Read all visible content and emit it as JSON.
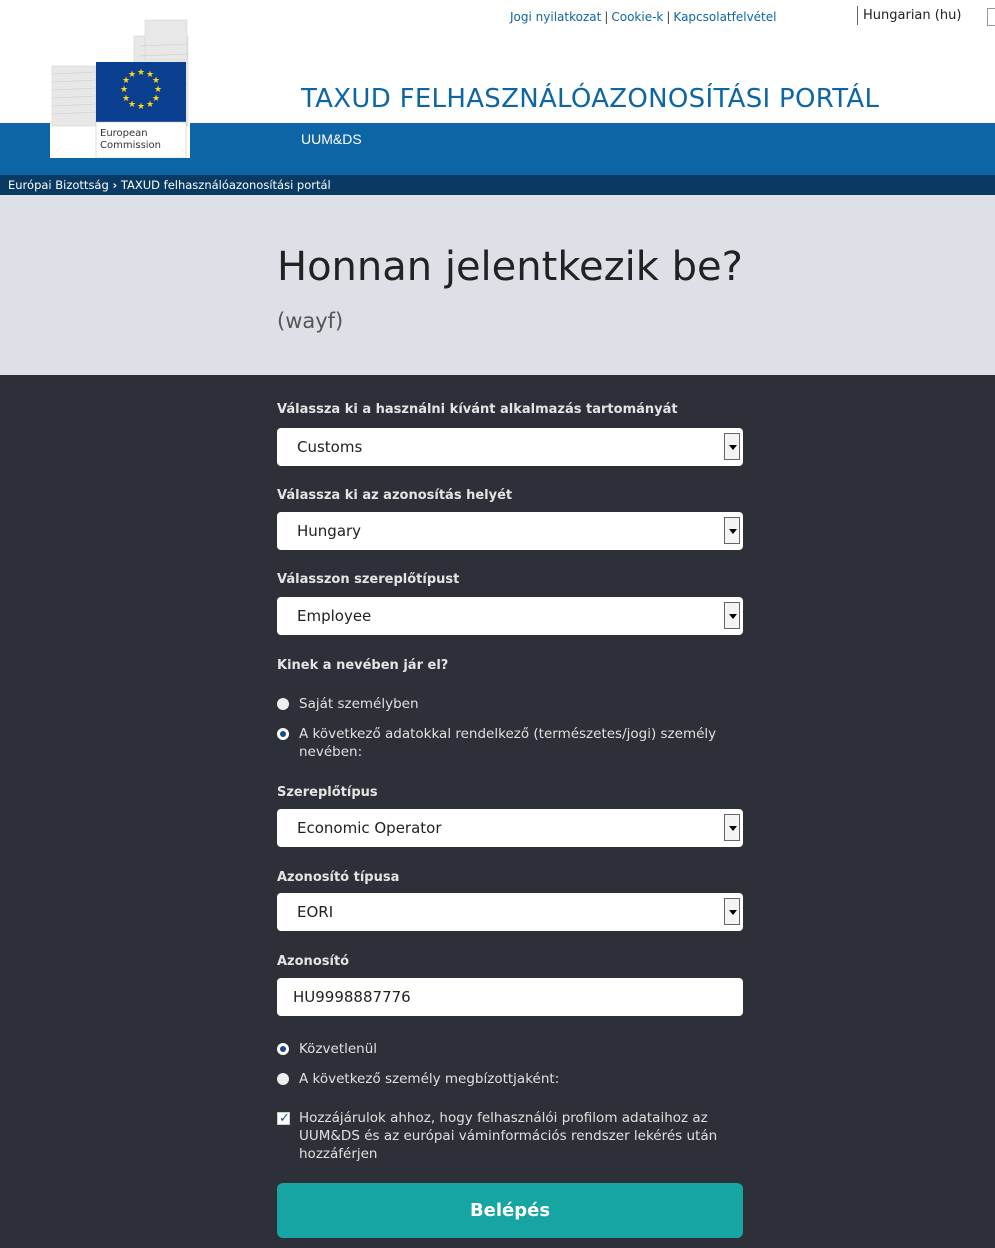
{
  "top_links": {
    "legal": "Jogi nyilatkozat",
    "cookies": "Cookie-k",
    "contact": "Kapcsolatfelvétel",
    "separator": "|",
    "language": "Hungarian (hu)"
  },
  "logo": {
    "line1": "European",
    "line2": "Commission"
  },
  "header": {
    "title": "TAXUD FELHASZNÁLÓAZONOSÍTÁSI PORTÁL",
    "subtitle": "UUM&DS"
  },
  "breadcrumb": {
    "item1": "Európai Bizottság",
    "separator": "›",
    "item2": "TAXUD felhasználóazonosítási portál"
  },
  "hero": {
    "title": "Honnan jelentkezik be?",
    "tag": "(wayf)"
  },
  "form": {
    "domain_label": "Válassza ki a használni kívánt alkalmazás tartományát",
    "domain_value": "Customs",
    "location_label": "Válassza ki az azonosítás helyét",
    "location_value": "Hungary",
    "actor_type_label": "Válasszon szereplőtípust",
    "actor_type_value": "Employee",
    "behalf_label": "Kinek a nevében jár el?",
    "behalf_options": [
      "Saját személyben",
      "A következő adatokkal rendelkező (természetes/jogi) személy nevében:"
    ],
    "behalf_selected": 1,
    "role_label": "Szereplőtípus",
    "role_value": "Economic Operator",
    "id_type_label": "Azonosító típusa",
    "id_type_value": "EORI",
    "id_label": "Azonosító",
    "id_value": "HU9998887776",
    "mode_options": [
      "Közvetlenül",
      "A következő személy megbízottjaként:"
    ],
    "mode_selected": 0,
    "consent_text": "Hozzájárulok ahhoz, hogy felhasználói profilom adataihoz az UUM&DS és az európai váminformációs rendszer lekérés után hozzáférjen",
    "consent_checked": true,
    "submit_label": "Belépés"
  },
  "colors": {
    "brand_blue": "#0e65a6",
    "dark_blue": "#083a63",
    "form_bg": "#2d3038",
    "hero_bg": "#dde1e7",
    "button": "#17a5a3",
    "eu_blue": "#0a3f8f",
    "eu_gold": "#ffd617"
  }
}
